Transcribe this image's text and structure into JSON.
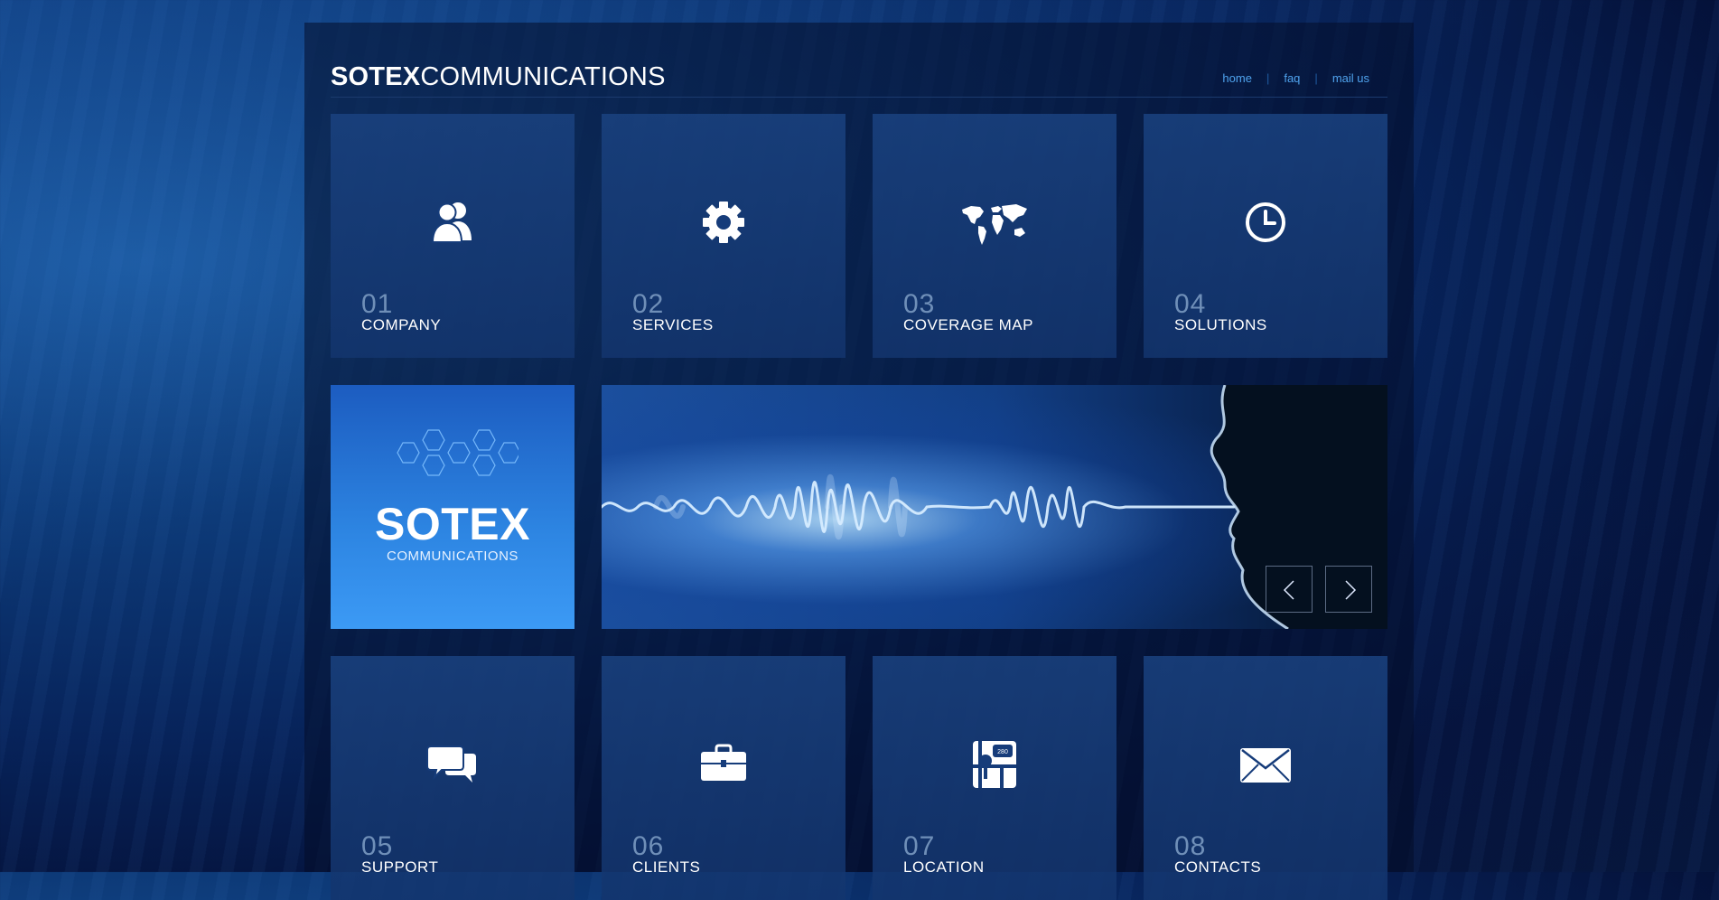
{
  "header": {
    "logo_bold": "SOTEX",
    "logo_light": "COMMUNICATIONS",
    "nav": [
      {
        "label": "home"
      },
      {
        "label": "faq"
      },
      {
        "label": "mail us"
      }
    ]
  },
  "tiles_top": [
    {
      "num": "01",
      "label": "COMPANY",
      "icon": "users-icon"
    },
    {
      "num": "02",
      "label": "SERVICES",
      "icon": "gear-icon"
    },
    {
      "num": "03",
      "label": "COVERAGE MAP",
      "icon": "world-map-icon"
    },
    {
      "num": "04",
      "label": "SOLUTIONS",
      "icon": "clock-icon"
    }
  ],
  "brand": {
    "title": "SOTEX",
    "subtitle": "COMMUNICATIONS"
  },
  "slider": {
    "prev_icon": "chevron-left-icon",
    "next_icon": "chevron-right-icon"
  },
  "tiles_bottom": [
    {
      "num": "05",
      "label": "SUPPORT",
      "icon": "chat-bubbles-icon"
    },
    {
      "num": "06",
      "label": "CLIENTS",
      "icon": "briefcase-icon"
    },
    {
      "num": "07",
      "label": "LOCATION",
      "icon": "map-pin-icon"
    },
    {
      "num": "08",
      "label": "CONTACTS",
      "icon": "envelope-icon"
    }
  ],
  "colors": {
    "accent": "#4fa3ee",
    "brand_tile": "#2d85e2",
    "tile_bg": "#163c7a"
  }
}
